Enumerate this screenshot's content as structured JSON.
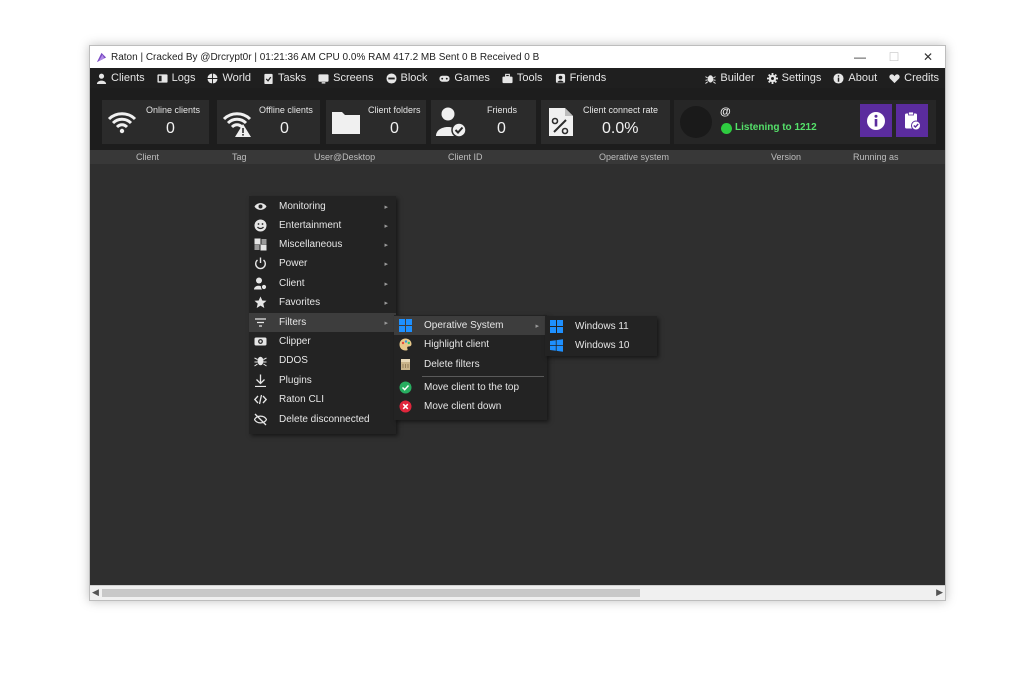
{
  "window": {
    "title": "Raton | Cracked By @Drcrypt0r | 01:21:36 AM CPU 0.0% RAM 417.2 MB Sent 0 B Received 0 B",
    "minimize": "—",
    "maximize": "☐",
    "close": "✕"
  },
  "menubar": {
    "left": [
      {
        "label": "Clients",
        "icon": "user-icon"
      },
      {
        "label": "Logs",
        "icon": "logs-icon"
      },
      {
        "label": "World",
        "icon": "globe-icon"
      },
      {
        "label": "Tasks",
        "icon": "clipboard-icon"
      },
      {
        "label": "Screens",
        "icon": "screen-icon"
      },
      {
        "label": "Block",
        "icon": "block-icon"
      },
      {
        "label": "Games",
        "icon": "gamepad-icon"
      },
      {
        "label": "Tools",
        "icon": "toolbox-icon"
      },
      {
        "label": "Friends",
        "icon": "friends-icon"
      }
    ],
    "right": [
      {
        "label": "Builder",
        "icon": "bug-icon"
      },
      {
        "label": "Settings",
        "icon": "gear-icon"
      },
      {
        "label": "About",
        "icon": "info-icon"
      },
      {
        "label": "Credits",
        "icon": "heart-icon"
      }
    ]
  },
  "stats": {
    "online": {
      "label": "Online clients",
      "value": "0"
    },
    "offline": {
      "label": "Offline clients",
      "value": "0"
    },
    "folders": {
      "label": "Client folders",
      "value": "0"
    },
    "friends": {
      "label": "Friends",
      "value": "0"
    },
    "rate": {
      "label": "Client connect rate",
      "value": "0.0%"
    }
  },
  "listener": {
    "at": "@",
    "status": "Listening to 1212",
    "status_color": "#2ecc40"
  },
  "columns": [
    "Client",
    "Tag",
    "User@Desktop",
    "Client ID",
    "Operative system",
    "Version",
    "Running as"
  ],
  "context_menu": {
    "items": [
      {
        "label": "Monitoring",
        "icon": "eye-icon",
        "submenu": true
      },
      {
        "label": "Entertainment",
        "icon": "smile-icon",
        "submenu": true
      },
      {
        "label": "Miscellaneous",
        "icon": "boxes-icon",
        "submenu": true
      },
      {
        "label": "Power",
        "icon": "power-icon",
        "submenu": true
      },
      {
        "label": "Client",
        "icon": "user-gear-icon",
        "submenu": true
      },
      {
        "label": "Favorites",
        "icon": "star-icon",
        "submenu": true
      },
      {
        "label": "Filters",
        "icon": "filter-icon",
        "submenu": true
      },
      {
        "label": "Clipper",
        "icon": "clipper-icon",
        "submenu": false
      },
      {
        "label": "DDOS",
        "icon": "bug-icon",
        "submenu": false
      },
      {
        "label": "Plugins",
        "icon": "download-icon",
        "submenu": false
      },
      {
        "label": "Raton CLI",
        "icon": "code-icon",
        "submenu": false
      },
      {
        "label": "Delete disconnected",
        "icon": "eye-off-icon",
        "submenu": false
      }
    ],
    "submenu_arrow": "▸"
  },
  "filters_menu": {
    "items": [
      {
        "label": "Operative System",
        "icon": "windows-icon",
        "submenu": true
      },
      {
        "label": "Highlight client",
        "icon": "palette-icon",
        "submenu": false
      },
      {
        "label": "Delete filters",
        "icon": "eraser-icon",
        "submenu": false
      },
      {
        "label": "Move client to the top",
        "icon": "check-circle-icon",
        "submenu": false
      },
      {
        "label": "Move client down",
        "icon": "x-circle-icon",
        "submenu": false
      }
    ]
  },
  "os_menu": {
    "items": [
      {
        "label": "Windows 11",
        "icon": "windows-icon"
      },
      {
        "label": "Windows 10",
        "icon": "windows-icon"
      }
    ]
  },
  "colors": {
    "accent_purple": "#5b2c9e",
    "menu_bg": "#1f1f1f",
    "content_bg": "#2f2f2f",
    "windows_blue": "#1e90ff"
  }
}
